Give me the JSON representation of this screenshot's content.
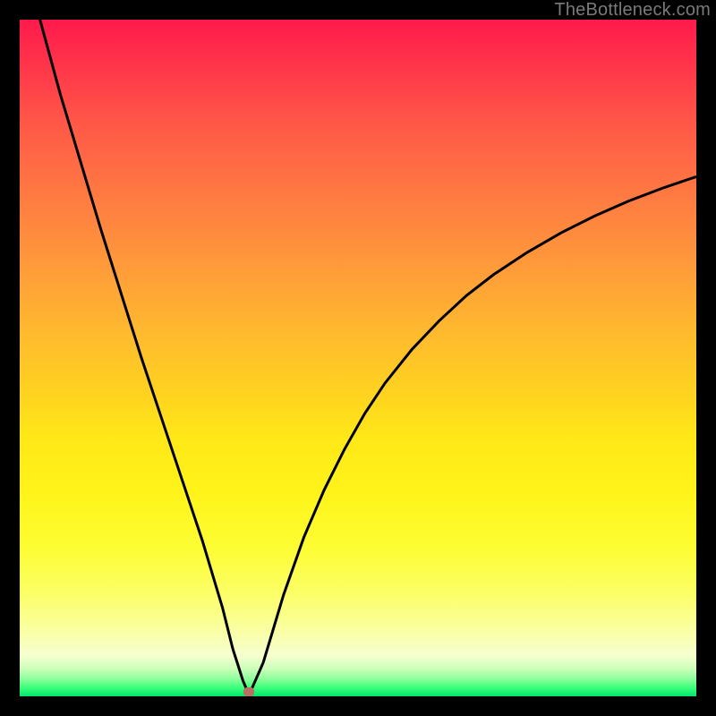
{
  "watermark": "TheBottleneck.com",
  "chart_data": {
    "type": "line",
    "title": "",
    "xlabel": "",
    "ylabel": "",
    "xlim": [
      0,
      100
    ],
    "ylim": [
      0,
      100
    ],
    "x": [
      3,
      6,
      9,
      12,
      15,
      18,
      21,
      24,
      27,
      30,
      31.5,
      33,
      33.9,
      36,
      39,
      42,
      45,
      48,
      51,
      54,
      58,
      62,
      66,
      70,
      75,
      80,
      85,
      90,
      95,
      100
    ],
    "values": [
      100,
      89,
      79,
      69,
      59.5,
      50,
      41,
      32,
      23,
      13,
      7,
      2.3,
      0.2,
      5,
      15,
      23.5,
      30.5,
      36.5,
      41.8,
      46.3,
      51.3,
      55.5,
      59.2,
      62.3,
      65.6,
      68.5,
      71,
      73.2,
      75.1,
      76.8
    ],
    "marker": {
      "x": 33.9,
      "y": 0.6
    },
    "gradient_colors": {
      "top": "#ff1a4b",
      "mid_upper": "#ff993a",
      "mid": "#ffe818",
      "mid_lower": "#fcff68",
      "bottom": "#00e56b"
    }
  }
}
